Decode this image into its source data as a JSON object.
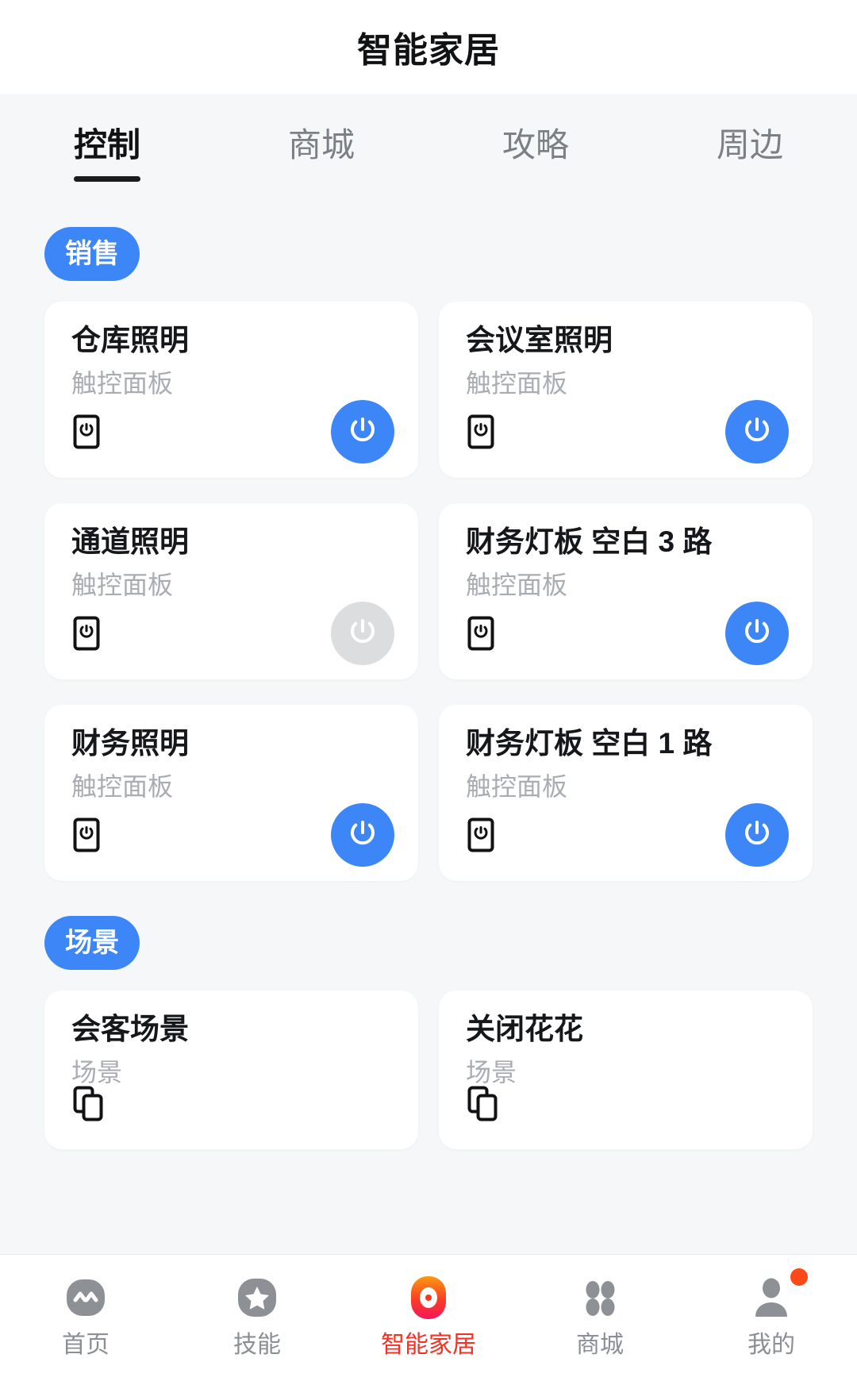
{
  "header": {
    "title": "智能家居"
  },
  "tabs": [
    {
      "label": "控制",
      "active": true
    },
    {
      "label": "商城",
      "active": false
    },
    {
      "label": "攻略",
      "active": false
    },
    {
      "label": "周边",
      "active": false
    }
  ],
  "colors": {
    "accent_blue": "#3d86f7",
    "power_off_gray": "#dcdddf",
    "active_nav_red": "#fa2e22",
    "page_bg": "#f6f7f8",
    "card_bg": "#ffffff",
    "subtitle_gray": "#a9adb2"
  },
  "groups": [
    {
      "badge": "销售",
      "cards": [
        {
          "title": "仓库照明",
          "subtitle": "触控面板",
          "device_icon": "touch-panel-icon",
          "power": "on"
        },
        {
          "title": "会议室照明",
          "subtitle": "触控面板",
          "device_icon": "touch-panel-icon",
          "power": "on"
        },
        {
          "title": "通道照明",
          "subtitle": "触控面板",
          "device_icon": "touch-panel-icon",
          "power": "off"
        },
        {
          "title": "财务灯板 空白 3 路",
          "subtitle": "触控面板",
          "device_icon": "touch-panel-icon",
          "power": "on"
        },
        {
          "title": "财务照明",
          "subtitle": "触控面板",
          "device_icon": "touch-panel-icon",
          "power": "on"
        },
        {
          "title": "财务灯板 空白 1 路",
          "subtitle": "触控面板",
          "device_icon": "touch-panel-icon",
          "power": "on"
        }
      ]
    },
    {
      "badge": "场景",
      "cards": [
        {
          "title": "会客场景",
          "subtitle": "场景",
          "device_icon": "scene-copy-icon",
          "power": "none"
        },
        {
          "title": "关闭花花",
          "subtitle": "场景",
          "device_icon": "scene-copy-icon",
          "power": "none"
        }
      ]
    }
  ],
  "bottom_nav": [
    {
      "label": "首页",
      "icon": "home-robot-icon",
      "active": false,
      "badge": false
    },
    {
      "label": "技能",
      "icon": "star-icon",
      "active": false,
      "badge": false
    },
    {
      "label": "智能家居",
      "icon": "smart-home-icon",
      "active": true,
      "badge": false
    },
    {
      "label": "商城",
      "icon": "grid-dots-icon",
      "active": false,
      "badge": false
    },
    {
      "label": "我的",
      "icon": "person-icon",
      "active": false,
      "badge": true
    }
  ]
}
